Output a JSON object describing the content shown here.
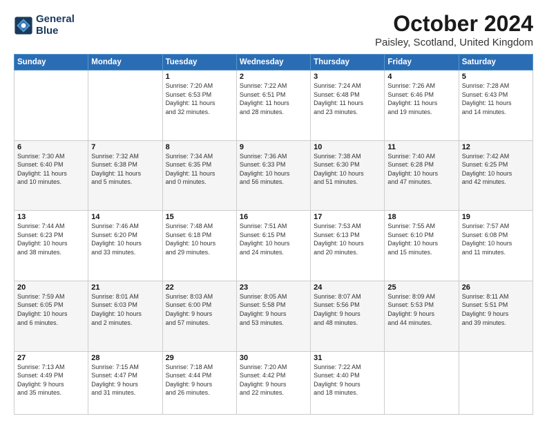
{
  "logo": {
    "line1": "General",
    "line2": "Blue"
  },
  "title": "October 2024",
  "subtitle": "Paisley, Scotland, United Kingdom",
  "days_of_week": [
    "Sunday",
    "Monday",
    "Tuesday",
    "Wednesday",
    "Thursday",
    "Friday",
    "Saturday"
  ],
  "weeks": [
    [
      {
        "day": "",
        "info": ""
      },
      {
        "day": "",
        "info": ""
      },
      {
        "day": "1",
        "info": "Sunrise: 7:20 AM\nSunset: 6:53 PM\nDaylight: 11 hours\nand 32 minutes."
      },
      {
        "day": "2",
        "info": "Sunrise: 7:22 AM\nSunset: 6:51 PM\nDaylight: 11 hours\nand 28 minutes."
      },
      {
        "day": "3",
        "info": "Sunrise: 7:24 AM\nSunset: 6:48 PM\nDaylight: 11 hours\nand 23 minutes."
      },
      {
        "day": "4",
        "info": "Sunrise: 7:26 AM\nSunset: 6:46 PM\nDaylight: 11 hours\nand 19 minutes."
      },
      {
        "day": "5",
        "info": "Sunrise: 7:28 AM\nSunset: 6:43 PM\nDaylight: 11 hours\nand 14 minutes."
      }
    ],
    [
      {
        "day": "6",
        "info": "Sunrise: 7:30 AM\nSunset: 6:40 PM\nDaylight: 11 hours\nand 10 minutes."
      },
      {
        "day": "7",
        "info": "Sunrise: 7:32 AM\nSunset: 6:38 PM\nDaylight: 11 hours\nand 5 minutes."
      },
      {
        "day": "8",
        "info": "Sunrise: 7:34 AM\nSunset: 6:35 PM\nDaylight: 11 hours\nand 0 minutes."
      },
      {
        "day": "9",
        "info": "Sunrise: 7:36 AM\nSunset: 6:33 PM\nDaylight: 10 hours\nand 56 minutes."
      },
      {
        "day": "10",
        "info": "Sunrise: 7:38 AM\nSunset: 6:30 PM\nDaylight: 10 hours\nand 51 minutes."
      },
      {
        "day": "11",
        "info": "Sunrise: 7:40 AM\nSunset: 6:28 PM\nDaylight: 10 hours\nand 47 minutes."
      },
      {
        "day": "12",
        "info": "Sunrise: 7:42 AM\nSunset: 6:25 PM\nDaylight: 10 hours\nand 42 minutes."
      }
    ],
    [
      {
        "day": "13",
        "info": "Sunrise: 7:44 AM\nSunset: 6:23 PM\nDaylight: 10 hours\nand 38 minutes."
      },
      {
        "day": "14",
        "info": "Sunrise: 7:46 AM\nSunset: 6:20 PM\nDaylight: 10 hours\nand 33 minutes."
      },
      {
        "day": "15",
        "info": "Sunrise: 7:48 AM\nSunset: 6:18 PM\nDaylight: 10 hours\nand 29 minutes."
      },
      {
        "day": "16",
        "info": "Sunrise: 7:51 AM\nSunset: 6:15 PM\nDaylight: 10 hours\nand 24 minutes."
      },
      {
        "day": "17",
        "info": "Sunrise: 7:53 AM\nSunset: 6:13 PM\nDaylight: 10 hours\nand 20 minutes."
      },
      {
        "day": "18",
        "info": "Sunrise: 7:55 AM\nSunset: 6:10 PM\nDaylight: 10 hours\nand 15 minutes."
      },
      {
        "day": "19",
        "info": "Sunrise: 7:57 AM\nSunset: 6:08 PM\nDaylight: 10 hours\nand 11 minutes."
      }
    ],
    [
      {
        "day": "20",
        "info": "Sunrise: 7:59 AM\nSunset: 6:05 PM\nDaylight: 10 hours\nand 6 minutes."
      },
      {
        "day": "21",
        "info": "Sunrise: 8:01 AM\nSunset: 6:03 PM\nDaylight: 10 hours\nand 2 minutes."
      },
      {
        "day": "22",
        "info": "Sunrise: 8:03 AM\nSunset: 6:00 PM\nDaylight: 9 hours\nand 57 minutes."
      },
      {
        "day": "23",
        "info": "Sunrise: 8:05 AM\nSunset: 5:58 PM\nDaylight: 9 hours\nand 53 minutes."
      },
      {
        "day": "24",
        "info": "Sunrise: 8:07 AM\nSunset: 5:56 PM\nDaylight: 9 hours\nand 48 minutes."
      },
      {
        "day": "25",
        "info": "Sunrise: 8:09 AM\nSunset: 5:53 PM\nDaylight: 9 hours\nand 44 minutes."
      },
      {
        "day": "26",
        "info": "Sunrise: 8:11 AM\nSunset: 5:51 PM\nDaylight: 9 hours\nand 39 minutes."
      }
    ],
    [
      {
        "day": "27",
        "info": "Sunrise: 7:13 AM\nSunset: 4:49 PM\nDaylight: 9 hours\nand 35 minutes."
      },
      {
        "day": "28",
        "info": "Sunrise: 7:15 AM\nSunset: 4:47 PM\nDaylight: 9 hours\nand 31 minutes."
      },
      {
        "day": "29",
        "info": "Sunrise: 7:18 AM\nSunset: 4:44 PM\nDaylight: 9 hours\nand 26 minutes."
      },
      {
        "day": "30",
        "info": "Sunrise: 7:20 AM\nSunset: 4:42 PM\nDaylight: 9 hours\nand 22 minutes."
      },
      {
        "day": "31",
        "info": "Sunrise: 7:22 AM\nSunset: 4:40 PM\nDaylight: 9 hours\nand 18 minutes."
      },
      {
        "day": "",
        "info": ""
      },
      {
        "day": "",
        "info": ""
      }
    ]
  ]
}
